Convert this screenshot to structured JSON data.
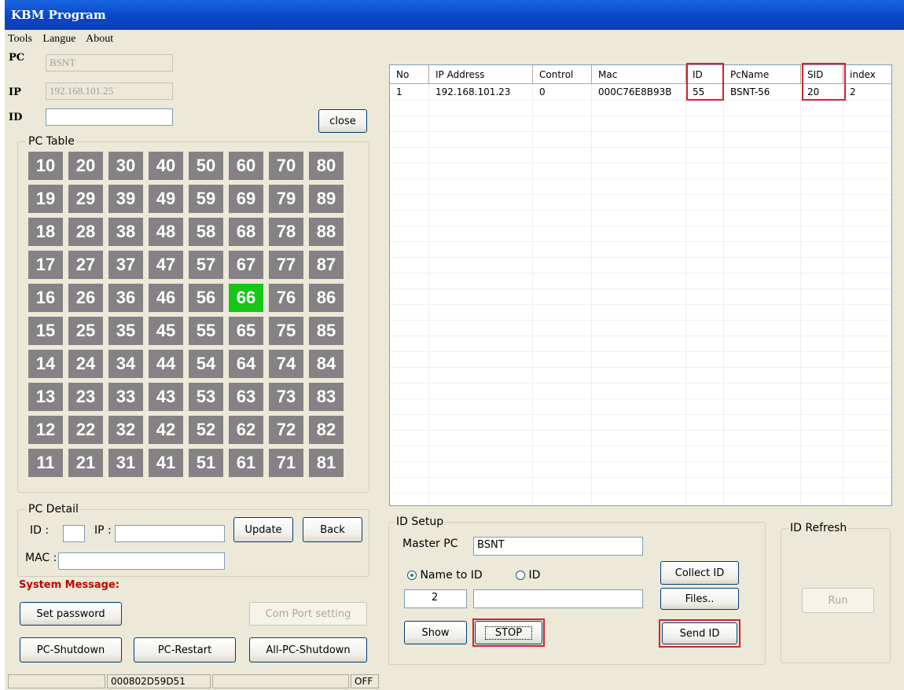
{
  "window": {
    "title": "KBM Program"
  },
  "menu": [
    "Tools",
    "Langue",
    "About"
  ],
  "fields": {
    "pc_label": "PC",
    "pc_value": "BSNT",
    "ip_label": "IP",
    "ip_value": "192.168.101.25",
    "id_label": "ID",
    "id_value": ""
  },
  "close_button": "close",
  "pc_table": {
    "title": "PC Table",
    "rows": [
      [
        "10",
        "20",
        "30",
        "40",
        "50",
        "60",
        "70",
        "80"
      ],
      [
        "19",
        "29",
        "39",
        "49",
        "59",
        "69",
        "79",
        "89"
      ],
      [
        "18",
        "28",
        "38",
        "48",
        "58",
        "68",
        "78",
        "88"
      ],
      [
        "17",
        "27",
        "37",
        "47",
        "57",
        "67",
        "77",
        "87"
      ],
      [
        "16",
        "26",
        "36",
        "46",
        "56",
        "66",
        "76",
        "86"
      ],
      [
        "15",
        "25",
        "35",
        "45",
        "55",
        "65",
        "75",
        "85"
      ],
      [
        "14",
        "24",
        "34",
        "44",
        "54",
        "64",
        "74",
        "84"
      ],
      [
        "13",
        "23",
        "33",
        "43",
        "53",
        "63",
        "73",
        "83"
      ],
      [
        "12",
        "22",
        "32",
        "42",
        "52",
        "62",
        "72",
        "82"
      ],
      [
        "11",
        "21",
        "31",
        "41",
        "51",
        "61",
        "71",
        "81"
      ]
    ],
    "active": "66",
    "active_color": "#17c617",
    "cell_color": "#848284"
  },
  "pc_detail": {
    "title": "PC Detail",
    "id_label": "ID :",
    "ip_label": "IP :",
    "mac_label": "MAC :",
    "update_button": "Update",
    "back_button": "Back"
  },
  "system_message": {
    "label": "System Message:",
    "color": "#c00000"
  },
  "buttons": {
    "set_password": "Set password",
    "com_port": "Com Port setting",
    "pc_shutdown": "PC-Shutdown",
    "pc_restart": "PC-Restart",
    "all_pc_shutdown": "All-PC-Shutdown"
  },
  "table": {
    "columns": [
      "No",
      "IP Address",
      "Control",
      "Mac",
      "ID",
      "PcName",
      "SID",
      "index"
    ],
    "rows": [
      [
        "1",
        "192.168.101.23",
        "0",
        "000C76E8B93B",
        "55",
        "BSNT-56",
        "20",
        "2"
      ]
    ],
    "highlight_color": "#d8202c"
  },
  "id_setup": {
    "title": "ID Setup",
    "master_pc_label": "Master PC",
    "master_pc_value": "BSNT",
    "radio_name_to_id": "Name to ID",
    "radio_id": "ID",
    "number_value": "2",
    "text_value": "",
    "collect_id_button": "Collect ID",
    "files_button": "Files..",
    "show_button": "Show",
    "stop_button": "STOP",
    "send_id_button": "Send ID"
  },
  "id_refresh": {
    "title": "ID Refresh",
    "run_button": "Run"
  },
  "statusbar": {
    "panel1": "",
    "panel2": "000802D59D51",
    "panel3": "",
    "panel4": "OFF"
  }
}
